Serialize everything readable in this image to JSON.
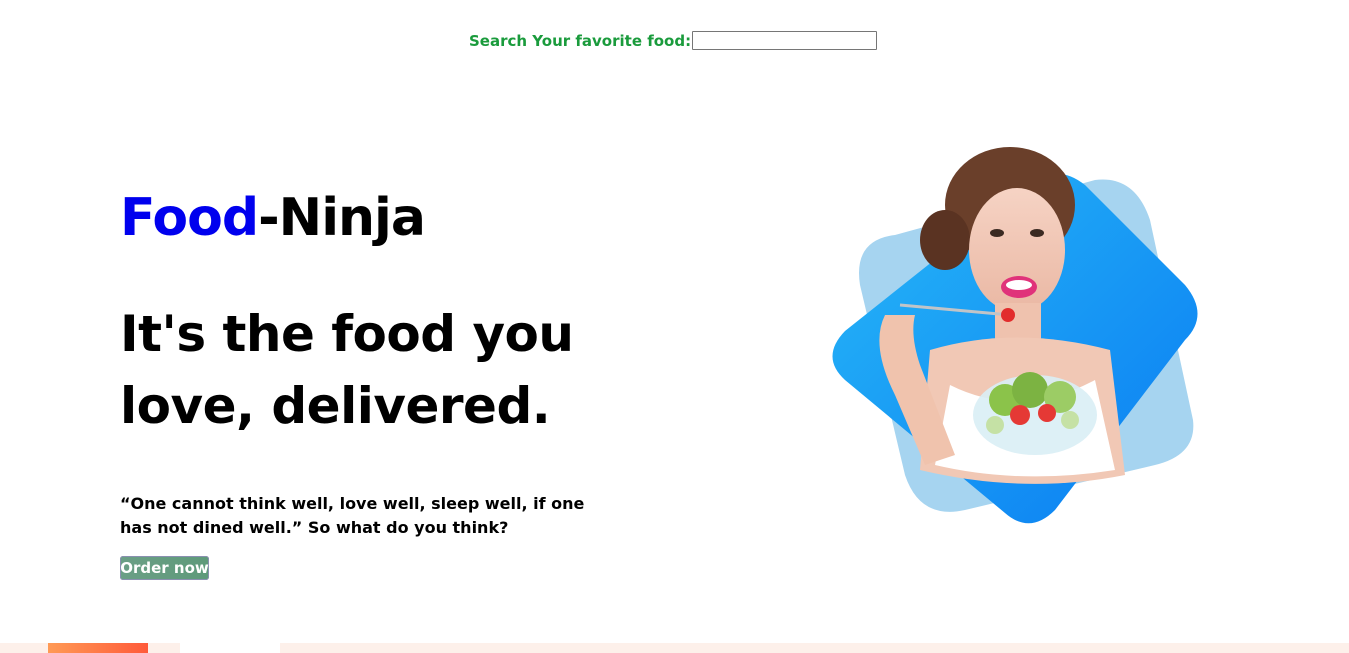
{
  "search": {
    "label": "Search Your favorite food:",
    "value": "",
    "placeholder": ""
  },
  "hero": {
    "brand_part1": "Food",
    "brand_part2": "-Ninja",
    "headline": "It's the food you love, delivered.",
    "quote": "“One cannot think well, love well, sleep well, if one has not dined well.” So what do you think?",
    "order_button": "Order now"
  },
  "colors": {
    "search_label": "#1a9b3c",
    "brand_food": "#0000ee",
    "blob_dark": "#1e8ef5",
    "blob_light": "#a6d4f0",
    "order_button": "#6b9f86",
    "bottom_accent": "#ff7a45"
  }
}
